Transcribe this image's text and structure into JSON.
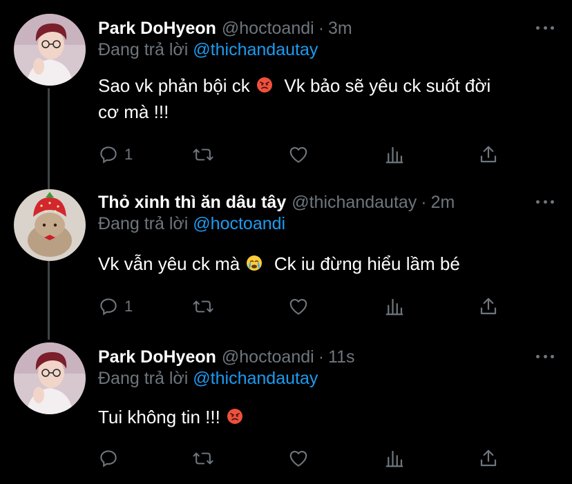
{
  "reply_prefix": "Đang trả lời",
  "tweets": [
    {
      "name": "Park DoHyeon",
      "handle": "@hoctoandi",
      "separator": "·",
      "time": "3m",
      "reply_to": "@thichandautay",
      "text_lines": [
        "Sao vk phản bội ck",
        "Vk bảo sẽ yêu ck suốt đời",
        "cơ mà !!!"
      ],
      "emoji": "angry-face",
      "reply_count": "1"
    },
    {
      "name": "Thỏ xinh thì ăn dâu tây",
      "handle": "@thichandautay",
      "separator": "·",
      "time": "2m",
      "reply_to": "@hoctoandi",
      "text_lines": [
        "Vk vẫn yêu ck mà",
        "Ck iu đừng hiểu lầm bé"
      ],
      "emoji": "crying-face",
      "reply_count": "1"
    },
    {
      "name": "Park DoHyeon",
      "handle": "@hoctoandi",
      "separator": "·",
      "time": "11s",
      "reply_to": "@thichandautay",
      "text_lines": [
        "Tui không tin !!!"
      ],
      "emoji": "angry-face",
      "reply_count": ""
    }
  ],
  "colors": {
    "background": "#000000",
    "muted": "#6e767d",
    "link": "#1d9bf0",
    "thread_line": "#3f4448"
  }
}
